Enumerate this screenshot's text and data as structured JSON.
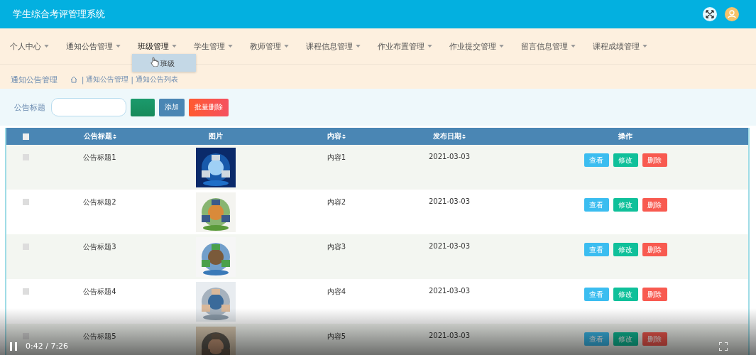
{
  "header": {
    "title": "学生综合考评管理系统"
  },
  "nav": [
    {
      "label": "个人中心"
    },
    {
      "label": "通知公告管理"
    },
    {
      "label": "班级管理",
      "expanded": true,
      "dropdown": [
        "班级"
      ]
    },
    {
      "label": "学生管理"
    },
    {
      "label": "教师管理"
    },
    {
      "label": "课程信息管理"
    },
    {
      "label": "作业布置管理"
    },
    {
      "label": "作业提交管理"
    },
    {
      "label": "留言信息管理"
    },
    {
      "label": "课程成绩管理"
    }
  ],
  "breadcrumb": {
    "section": "通知公告管理",
    "separator": "|",
    "path": [
      "通知公告管理",
      "通知公告列表"
    ]
  },
  "search": {
    "label": "公告标题",
    "buttons": [
      {
        "kind": "search"
      },
      {
        "kind": "add",
        "label": "添加"
      },
      {
        "kind": "bulk-delete",
        "label": "批量删除"
      }
    ]
  },
  "table": {
    "select_all": {
      "checked": false
    },
    "columns": [
      {
        "label": "公告标题",
        "sortable": true
      },
      {
        "label": "图片",
        "sortable": false
      },
      {
        "label": "内容",
        "sortable": true
      },
      {
        "label": "发布日期",
        "sortable": true
      },
      {
        "label": "操作",
        "sortable": false
      }
    ],
    "rows": [
      {
        "checked": false,
        "title": "公告标题1",
        "content": "内容1",
        "date": "2021-03-03",
        "actions": [
          "查看",
          "修改",
          "删除"
        ]
      },
      {
        "checked": false,
        "title": "公告标题2",
        "content": "内容2",
        "date": "2021-03-03",
        "actions": [
          "查看",
          "修改",
          "删除"
        ]
      },
      {
        "checked": false,
        "title": "公告标题3",
        "content": "内容3",
        "date": "2021-03-03",
        "actions": [
          "查看",
          "修改",
          "删除"
        ]
      },
      {
        "checked": false,
        "title": "公告标题4",
        "content": "内容4",
        "date": "2021-03-03",
        "actions": [
          "查看",
          "修改",
          "删除"
        ]
      },
      {
        "checked": false,
        "title": "公告标题5",
        "content": "内容5",
        "date": "2021-03-03",
        "actions": [
          "查看",
          "修改",
          "删除"
        ]
      }
    ]
  },
  "video_player": {
    "playing": true,
    "time": "0:42 / 7:26"
  }
}
